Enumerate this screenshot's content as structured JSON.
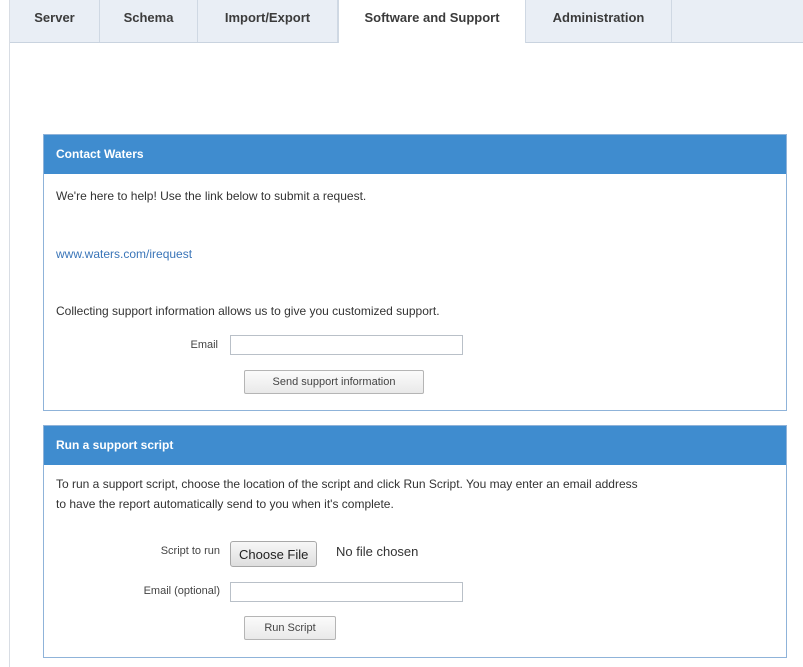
{
  "tabs": [
    {
      "label": "Server"
    },
    {
      "label": "Schema"
    },
    {
      "label": "Import/Export"
    },
    {
      "label": "Software and Support",
      "active": true
    },
    {
      "label": "Administration"
    }
  ],
  "contact": {
    "title": "Contact Waters",
    "intro": "We're here to help! Use the link below to submit a request.",
    "link": "www.waters.com/irequest",
    "collecting_text": "Collecting support information allows us to give you customized support.",
    "email_label": "Email",
    "email_value": "",
    "send_button": "Send support information"
  },
  "script": {
    "title": "Run a support script",
    "description_line1": "To run a support script, choose the location of the script and click Run Script. You may enter an email address",
    "description_line2": "to have the report automatically send to you when it's complete.",
    "script_label": "Script to run",
    "choose_file": "Choose File",
    "no_file": "No file chosen",
    "email_label": "Email (optional)",
    "email_value": "",
    "run_button": "Run Script"
  },
  "colors": {
    "header": "#3f8ccf",
    "link": "#3a75b8",
    "tabbar": "#e9eef5"
  }
}
